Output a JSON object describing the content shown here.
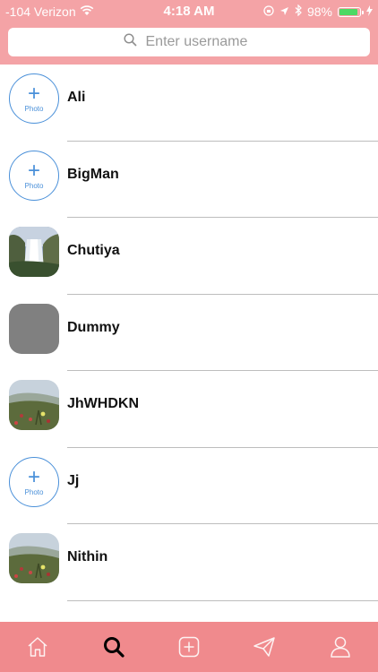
{
  "status": {
    "signal": "-104 Verizon",
    "time": "4:18 AM",
    "battery": "98%",
    "battery_level": 0.98
  },
  "search": {
    "placeholder": "Enter username"
  },
  "users": [
    {
      "name": "Ali",
      "avatar": "placeholder"
    },
    {
      "name": "BigMan",
      "avatar": "placeholder"
    },
    {
      "name": "Chutiya",
      "avatar": "waterfall"
    },
    {
      "name": "Dummy",
      "avatar": "gray"
    },
    {
      "name": "JhWHDKN",
      "avatar": "meadow"
    },
    {
      "name": "Jj",
      "avatar": "placeholder"
    },
    {
      "name": "Nithin",
      "avatar": "meadow"
    }
  ],
  "photo_label": "Photo",
  "tabs": [
    {
      "icon": "home-icon",
      "active": false
    },
    {
      "icon": "search-icon",
      "active": true
    },
    {
      "icon": "add-icon",
      "active": false
    },
    {
      "icon": "send-icon",
      "active": false
    },
    {
      "icon": "profile-icon",
      "active": false
    }
  ],
  "colors": {
    "header": "#f4a3a6",
    "tabbar": "#f08a8d",
    "accent_blue": "#4a90d9"
  }
}
